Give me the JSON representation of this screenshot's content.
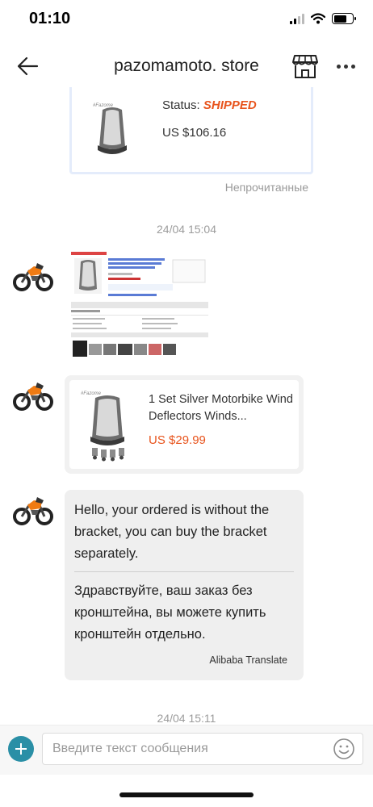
{
  "status_bar": {
    "time": "01:10"
  },
  "header": {
    "title": "pazomamoto. store"
  },
  "order_card": {
    "status_label": "Status:",
    "status_value": "SHIPPED",
    "price": "US $106.16"
  },
  "unread_label": "Непрочитанные",
  "timestamps": [
    "24/04 15:04",
    "24/04 15:11"
  ],
  "product_card": {
    "title": "1 Set Silver Motorbike Wind Deflectors Winds...",
    "price": "US $29.99"
  },
  "message": {
    "text_en": "Hello, your ordered is without the bracket, you can buy the bracket separately.",
    "text_ru": "Здравствуйте, ваш заказ без кронштейна, вы можете купить кронштейн отдельно.",
    "credit": "Alibaba Translate"
  },
  "input_bar": {
    "placeholder": "Введите текст сообщения"
  },
  "colors": {
    "accent_orange": "#e8541d",
    "add_button": "#2a8fa6",
    "order_card_border": "#e4ecfb"
  },
  "icons": {
    "back": "arrow-left-icon",
    "store": "storefront-icon",
    "more": "more-horizontal-icon",
    "add": "plus-icon",
    "emoji": "smiley-icon"
  }
}
